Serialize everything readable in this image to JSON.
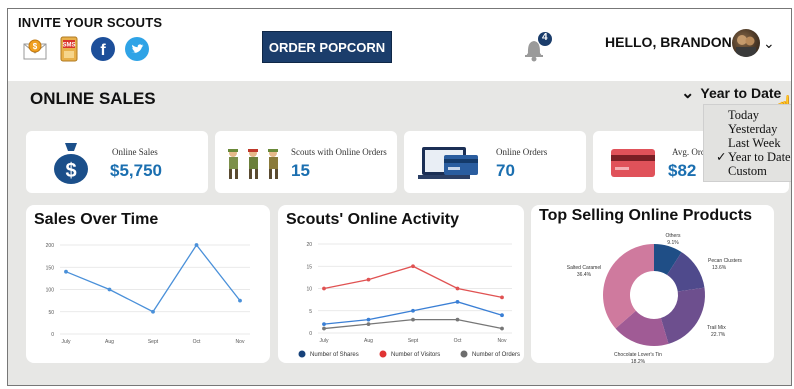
{
  "header": {
    "invite_title": "INVITE YOUR SCOUTS",
    "invite_icons": [
      "email-icon",
      "sms-icon",
      "facebook-icon",
      "twitter-icon"
    ],
    "order_button": "ORDER POPCORN",
    "notification_count": "4",
    "greeting": "HELLO, BRANDON!"
  },
  "section": {
    "title": "ONLINE SALES",
    "range_selector": "Year to Date",
    "range_options": [
      {
        "label": "Today",
        "selected": false
      },
      {
        "label": "Yesterday",
        "selected": false
      },
      {
        "label": "Last Week",
        "selected": false
      },
      {
        "label": "Year to Date",
        "selected": true
      },
      {
        "label": "Custom",
        "selected": false
      }
    ]
  },
  "kpis": [
    {
      "label": "Online Sales",
      "value": "$5,750",
      "icon": "money-bag-icon"
    },
    {
      "label": "Scouts with Online Orders",
      "value": "15",
      "icon": "scouts-icon"
    },
    {
      "label": "Online Orders",
      "value": "70",
      "icon": "laptop-card-icon"
    },
    {
      "label": "Avg. Ord",
      "value": "$82",
      "icon": "credit-card-icon"
    }
  ],
  "colors": {
    "accent": "#1b3d6b",
    "kpi_value": "#1b6fb0",
    "panel_bg": "#e7e7e5"
  },
  "charts": {
    "sales_over_time": {
      "title": "Sales Over Time",
      "chart_data": {
        "type": "line",
        "categories": [
          "July",
          "Aug",
          "Sept",
          "Oct",
          "Nov"
        ],
        "y_ticks": [
          "0",
          "50",
          "100",
          "150",
          "200"
        ],
        "ylim": [
          0,
          200
        ],
        "series": [
          {
            "values": [
              140,
              100,
              50,
              200,
              75
            ],
            "color": "#4a90d9"
          }
        ]
      }
    },
    "scouts_activity": {
      "title": "Scouts' Online Activity",
      "chart_data": {
        "type": "line",
        "categories": [
          "July",
          "Aug",
          "Sept",
          "Oct",
          "Nov"
        ],
        "y_ticks": [
          "0",
          "5",
          "10",
          "15",
          "20"
        ],
        "ylim": [
          0,
          20
        ],
        "series": [
          {
            "name": "Number of Shares",
            "values": [
              2,
              3,
              5,
              7,
              4
            ],
            "color": "#3a7fd5"
          },
          {
            "name": "Number of Visitors",
            "values": [
              10,
              12,
              15,
              10,
              8
            ],
            "color": "#e05252"
          },
          {
            "name": "Number of Orders",
            "values": [
              1,
              2,
              3,
              3,
              1
            ],
            "color": "#777777"
          }
        ],
        "legend_colors": [
          "#17427a",
          "#e03333",
          "#6d6d6d"
        ]
      }
    },
    "top_products": {
      "title": "Top Selling Online Products",
      "chart_data": {
        "type": "pie",
        "slices": [
          {
            "label": "Others",
            "value_label": "9.1%",
            "value": 9.1,
            "color": "#1f4e86"
          },
          {
            "label": "Pecan Clusters",
            "value_label": "13.6%",
            "value": 13.6,
            "color": "#4f4a8c"
          },
          {
            "label": "Trail Mix",
            "value_label": "22.7%",
            "value": 22.7,
            "color": "#6d4f8e"
          },
          {
            "label": "Chocolate Lover's Tin",
            "value_label": "18.2%",
            "value": 18.2,
            "color": "#a05b95"
          },
          {
            "label": "Salted Caramel",
            "value_label": "36.4%",
            "value": 36.4,
            "color": "#cf7a9e"
          }
        ]
      }
    }
  }
}
